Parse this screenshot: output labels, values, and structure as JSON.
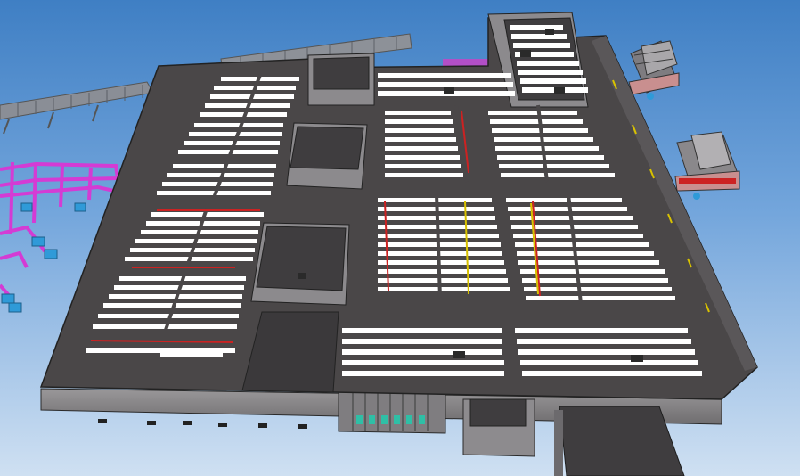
{
  "viewport": {
    "view": "3d-model-viewport",
    "sky_top": "#3f7fc4",
    "sky_bottom": "#cfe0f2"
  },
  "model": {
    "roof_color": "#4a4748",
    "light_panel_color": "#ffffff",
    "wall_color": "#8c8a8c",
    "duct_color": "#d43bd4",
    "equipment_color": "#2f9ad8",
    "edge_color": "#222222",
    "accent_red": "#cc2222",
    "accent_yellow": "#d9c200"
  }
}
